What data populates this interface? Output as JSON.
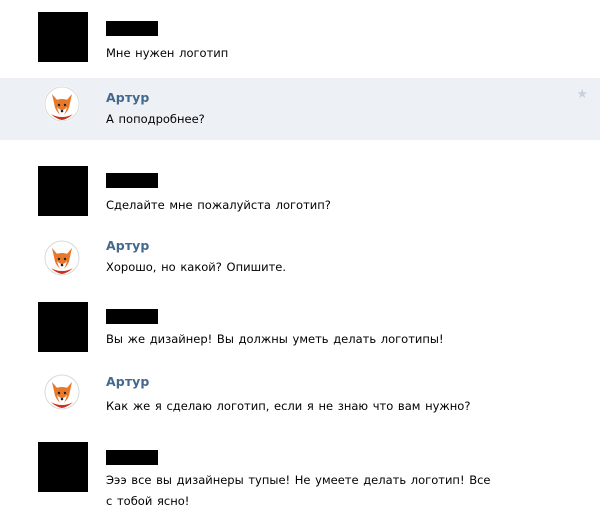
{
  "messages": [
    {
      "type": "redacted",
      "text": "Мне нужен логотип"
    },
    {
      "type": "named",
      "author": "Артур",
      "text": "А поподробнее?"
    },
    {
      "type": "redacted",
      "text": "Сделайте мне пожалуйста логотип?"
    },
    {
      "type": "named",
      "author": "Артур",
      "text": "Хорошо, но какой? Опишите."
    },
    {
      "type": "redacted",
      "text": "Вы же дизайнер! Вы должны уметь делать логотипы!"
    },
    {
      "type": "named",
      "author": "Артур",
      "text": "Как же я сделаю логотип, если я не знаю что вам нужно?"
    },
    {
      "type": "redacted",
      "text_line1": "Эээ все вы дизайнеры тупые! Не умеете делать логотип! Все",
      "text_line2": "с тобой ясно!"
    }
  ],
  "icons": {
    "star": "star-icon",
    "fox_avatar": "fox-avatar-icon"
  },
  "colors": {
    "highlight_bg": "#edf1f5",
    "author_name": "#45688e",
    "star": "#c7d2dd"
  }
}
